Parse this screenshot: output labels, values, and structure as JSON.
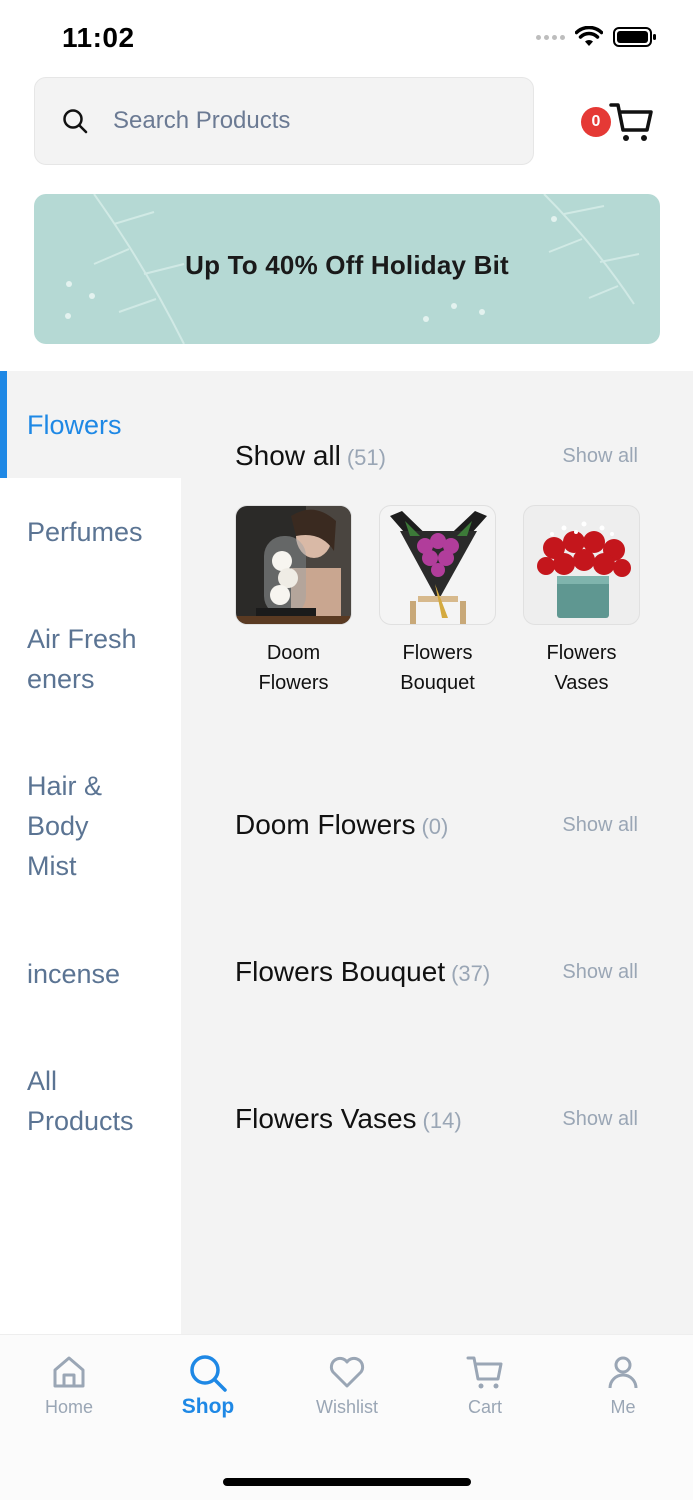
{
  "status": {
    "time": "11:02"
  },
  "search": {
    "placeholder": "Search Products"
  },
  "cart": {
    "count": "0"
  },
  "banner": {
    "text": "Up To 40%  Off Holiday Bit"
  },
  "sidebar": {
    "items": [
      {
        "label": "Flowers",
        "active": true
      },
      {
        "label": "Perfumes"
      },
      {
        "label": "Air Fresh\neners"
      },
      {
        "label": "Hair &\nBody\nMist"
      },
      {
        "label": "incense"
      },
      {
        "label": "All\nProducts"
      }
    ]
  },
  "sections": [
    {
      "title": "Show all",
      "count": "(51)",
      "link": "Show all"
    },
    {
      "title": "Doom Flowers",
      "count": "(0)",
      "link": "Show all"
    },
    {
      "title": "Flowers Bouquet",
      "count": "(37)",
      "link": "Show all"
    },
    {
      "title": "Flowers Vases",
      "count": "(14)",
      "link": "Show all"
    }
  ],
  "subcategories": [
    {
      "label": "Doom\nFlowers"
    },
    {
      "label": "Flowers\nBouquet"
    },
    {
      "label": "Flowers\nVases"
    }
  ],
  "tabbar": {
    "items": [
      {
        "label": "Home",
        "icon": "home-icon"
      },
      {
        "label": "Shop",
        "icon": "search-icon",
        "active": true
      },
      {
        "label": "Wishlist",
        "icon": "heart-icon"
      },
      {
        "label": "Cart",
        "icon": "cart-icon"
      },
      {
        "label": "Me",
        "icon": "user-icon"
      }
    ]
  },
  "colors": {
    "accent": "#1e88e5",
    "badge": "#e53935",
    "banner": "#b5d9d4",
    "muted": "#9aa6b5",
    "sidebar_text": "#5b7493"
  }
}
